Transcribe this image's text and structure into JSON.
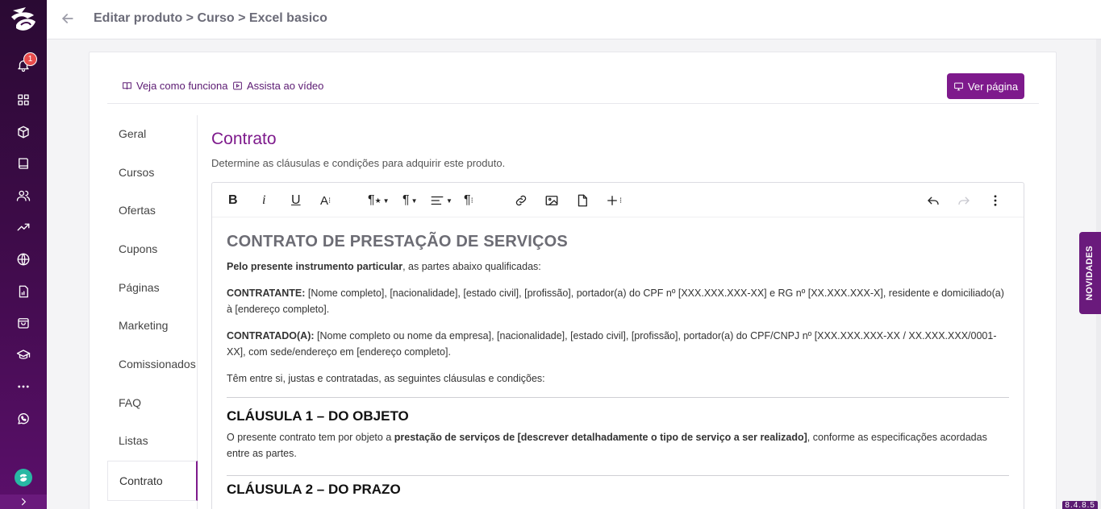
{
  "topbar": {
    "breadcrumb": "Editar produto > Curso > Excel basico"
  },
  "rail": {
    "notification_count": "1",
    "icons": [
      "bell-icon",
      "grid-icon",
      "box-icon",
      "book-icon",
      "users-icon",
      "trending-icon",
      "globe-icon",
      "report-icon",
      "bag-icon",
      "graduation-icon",
      "more-icon",
      "whatsapp-icon"
    ]
  },
  "helpbar": {
    "how_it_works": "Veja como funciona",
    "watch_video": "Assista ao vídeo",
    "view_page": "Ver página"
  },
  "side_menu": {
    "items": [
      "Geral",
      "Cursos",
      "Ofertas",
      "Cupons",
      "Páginas",
      "Marketing",
      "Comissionados",
      "FAQ",
      "Listas",
      "Contrato"
    ],
    "active": "Contrato"
  },
  "section": {
    "title": "Contrato",
    "subtitle": "Determine as cláusulas e condições para adquirir este produto."
  },
  "editor": {
    "doc": {
      "heading": "CONTRATO DE PRESTAÇÃO DE SERVIÇOS",
      "intro_bold": "Pelo presente instrumento particular",
      "intro_rest": ", as partes abaixo qualificadas:",
      "contratante_label": "CONTRATANTE:",
      "contratante_text": " [Nome completo], [nacionalidade], [estado civil], [profissão], portador(a) do CPF nº [XXX.XXX.XXX-XX] e RG nº [XX.XXX.XXX-X], residente e domiciliado(a) à [endereço completo].",
      "contratado_label": "CONTRATADO(A):",
      "contratado_text": " [Nome completo ou nome da empresa], [nacionalidade], [estado civil], [profissão], portador(a) do CPF/CNPJ nº [XXX.XXX.XXX-XX / XX.XXX.XXX/0001-XX], com sede/endereço em [endereço completo].",
      "agreement": "Têm entre si, justas e contratadas, as seguintes cláusulas e condições:",
      "clause1_title": "CLÁUSULA 1 – DO OBJETO",
      "clause1_pre": "O presente contrato tem por objeto a ",
      "clause1_bold": "prestação de serviços de [descrever detalhadamente o tipo de serviço a ser realizado]",
      "clause1_post": ", conforme as especificações acordadas entre as partes.",
      "clause2_title": "CLÁUSULA 2 – DO PRAZO"
    }
  },
  "novidades_label": "NOVIDADES",
  "version": "8.4.8.5",
  "colors": {
    "brand": "#7e1a8c",
    "rail": "#3d0b48"
  }
}
